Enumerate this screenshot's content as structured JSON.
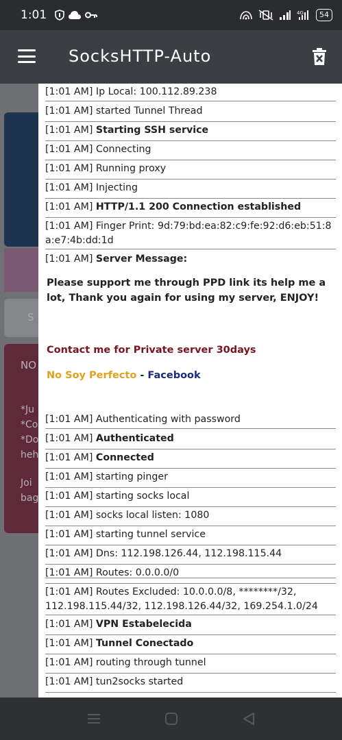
{
  "status": {
    "time": "1:01",
    "battery": "54"
  },
  "app": {
    "title": "SocksHTTP-Auto"
  },
  "background": {
    "text_lines": [
      "NO",
      "*Ju",
      "*Co",
      "*Do",
      "heh",
      "Joi",
      "bag",
      "S"
    ]
  },
  "logs": [
    {
      "prefix": "[1:01 AM] ",
      "text": "Ip Local: 100.112.89.238",
      "bold": false
    },
    {
      "prefix": "[1:01 AM] ",
      "text": "started Tunnel Thread",
      "bold": false
    },
    {
      "prefix": "[1:01 AM] ",
      "text": "Starting SSH service",
      "bold": true
    },
    {
      "prefix": "[1:01 AM] ",
      "text": "Connecting",
      "bold": false
    },
    {
      "prefix": "[1:01 AM] ",
      "text": "Running proxy",
      "bold": false
    },
    {
      "prefix": "[1:01 AM] ",
      "text": "Injecting",
      "bold": false
    },
    {
      "prefix": "[1:01 AM] ",
      "text": "HTTP/1.1 200 Connection established",
      "bold": true
    },
    {
      "prefix": "[1:01 AM] ",
      "text": "Finger Print: 9d:79:bd:ea:82:c9:fe:92:d6:eb:51:8a:e7:4b:dd:1d",
      "bold": false
    },
    {
      "prefix": "[1:01 AM] ",
      "text": "Server Message:",
      "bold": true
    },
    {
      "prefix": "[1:01 AM] ",
      "text": "Authenticating with password",
      "bold": false
    },
    {
      "prefix": "[1:01 AM] ",
      "text": "Authenticated",
      "bold": true
    },
    {
      "prefix": "[1:01 AM] ",
      "text": "Connected",
      "bold": true
    },
    {
      "prefix": "[1:01 AM] ",
      "text": "starting pinger",
      "bold": false
    },
    {
      "prefix": "[1:01 AM] ",
      "text": "starting socks local",
      "bold": false
    },
    {
      "prefix": "[1:01 AM] ",
      "text": "socks local listen: 1080",
      "bold": false
    },
    {
      "prefix": "[1:01 AM] ",
      "text": "starting tunnel service",
      "bold": false
    },
    {
      "prefix": "[1:01 AM] ",
      "text": "Dns: 112.198.126.44, 112.198.115.44",
      "bold": false
    },
    {
      "prefix": "[1:01 AM] ",
      "text": "Routes: 0.0.0.0/0",
      "bold": false
    },
    {
      "prefix": "[1:01 AM] ",
      "text": "Routes Excluded: 10.0.0.0/8, ********/32, 112.198.115.44/32, 112.198.126.44/32, 169.254.1.0/24",
      "bold": false
    },
    {
      "prefix": "[1:01 AM] ",
      "text": "VPN Estabelecida",
      "bold": true
    },
    {
      "prefix": "[1:01 AM] ",
      "text": "Tunnel Conectado",
      "bold": true
    },
    {
      "prefix": "[1:01 AM] ",
      "text": "routing through tunnel",
      "bold": false
    },
    {
      "prefix": "[1:01 AM] ",
      "text": "tun2socks started",
      "bold": false
    }
  ],
  "server_message": {
    "support": "Please support me through PPD link its help me a lot, Thank you again for using my server, ENJOY!",
    "contact": "Contact me for Private server 30days",
    "link1": "No Soy Perfecto",
    "separator": " - ",
    "link2": "Facebook"
  }
}
